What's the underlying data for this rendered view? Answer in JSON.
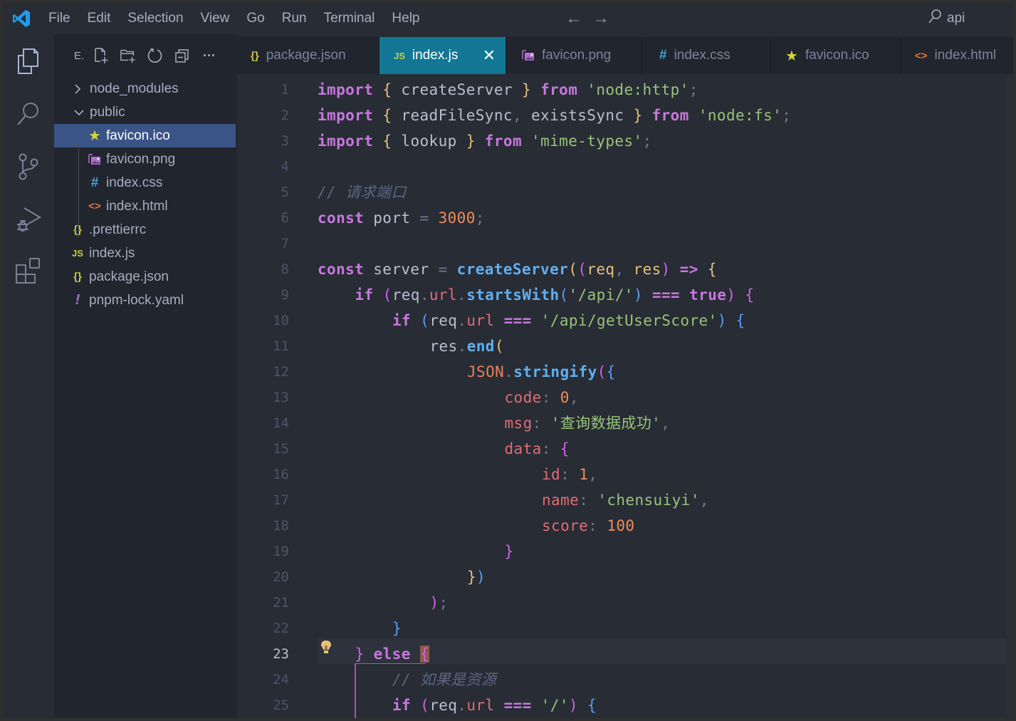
{
  "app": {
    "menu": [
      "File",
      "Edit",
      "Selection",
      "View",
      "Go",
      "Run",
      "Terminal",
      "Help"
    ],
    "nav": {
      "back": "←",
      "forward": "→"
    },
    "command_center": {
      "icon": "search-icon",
      "text": "api"
    }
  },
  "activity_bar": [
    {
      "name": "explorer",
      "icon": "files-icon",
      "active": true
    },
    {
      "name": "search",
      "icon": "search-icon"
    },
    {
      "name": "source-control",
      "icon": "source-control-icon"
    },
    {
      "name": "run-and-debug",
      "icon": "run-debug-icon"
    },
    {
      "name": "extensions",
      "icon": "extensions-icon"
    }
  ],
  "explorer": {
    "title": "E.",
    "actions": [
      "new-file",
      "new-folder",
      "refresh",
      "collapse-all",
      "more"
    ],
    "more_label": "···",
    "tree": [
      {
        "label": "node_modules",
        "type": "folder",
        "expanded": false,
        "depth": 0
      },
      {
        "label": "public",
        "type": "folder",
        "expanded": true,
        "depth": 0
      },
      {
        "label": "favicon.ico",
        "type": "file",
        "icon": "star-icon",
        "icon_glyph": "★",
        "icon_color": "#d4d43a",
        "depth": 1,
        "selected": true
      },
      {
        "label": "favicon.png",
        "type": "file",
        "icon": "image-icon",
        "icon_glyph": "🖼",
        "icon_color": "#b46fd1",
        "depth": 1
      },
      {
        "label": "index.css",
        "type": "file",
        "icon": "hash-icon",
        "icon_glyph": "#",
        "icon_color": "#42a5d5",
        "depth": 1
      },
      {
        "label": "index.html",
        "type": "file",
        "icon": "html-icon",
        "icon_glyph": "<>",
        "icon_color": "#e6773a",
        "depth": 1
      },
      {
        "label": ".prettierrc",
        "type": "file",
        "icon": "braces-icon",
        "icon_glyph": "{}",
        "icon_color": "#cbcb41",
        "depth": 0
      },
      {
        "label": "index.js",
        "type": "file",
        "icon": "js-icon",
        "icon_glyph": "JS",
        "icon_color": "#cbcb41",
        "depth": 0
      },
      {
        "label": "package.json",
        "type": "file",
        "icon": "braces-icon",
        "icon_glyph": "{}",
        "icon_color": "#cbcb41",
        "depth": 0
      },
      {
        "label": "pnpm-lock.yaml",
        "type": "file",
        "icon": "exclamation-icon",
        "icon_glyph": "!",
        "icon_color": "#a074c4",
        "depth": 0
      }
    ]
  },
  "tabs": [
    {
      "label": "package.json",
      "icon": "braces-icon",
      "icon_glyph": "{}",
      "icon_color": "#cbcb41"
    },
    {
      "label": "index.js",
      "icon": "js-icon",
      "icon_glyph": "JS",
      "icon_color": "#cbcb41",
      "active": true,
      "close": "✕"
    },
    {
      "label": "favicon.png",
      "icon": "image-icon",
      "icon_glyph": "🖼",
      "icon_color": "#b46fd1"
    },
    {
      "label": "index.css",
      "icon": "hash-icon",
      "icon_glyph": "#",
      "icon_color": "#42a5d5"
    },
    {
      "label": "favicon.ico",
      "icon": "star-icon",
      "icon_glyph": "★",
      "icon_color": "#d4d43a"
    },
    {
      "label": "index.html",
      "icon": "html-icon",
      "icon_glyph": "<>",
      "icon_color": "#e6773a"
    }
  ],
  "editor": {
    "current_line": 23,
    "lines": [
      [
        [
          "kw",
          "import"
        ],
        [
          "",
          "  "
        ],
        [
          "b1",
          "{"
        ],
        [
          "",
          " createServer "
        ],
        [
          "b1",
          "}"
        ],
        [
          "",
          " "
        ],
        [
          "kw",
          "from"
        ],
        [
          "",
          " "
        ],
        [
          "str",
          "'node:http'"
        ],
        [
          "pun",
          ";"
        ]
      ],
      [
        [
          "kw",
          "import"
        ],
        [
          "",
          " "
        ],
        [
          "b1",
          "{"
        ],
        [
          "",
          " readFileSync"
        ],
        [
          "pun",
          ","
        ],
        [
          "",
          " existsSync "
        ],
        [
          "b1",
          "}"
        ],
        [
          "",
          " "
        ],
        [
          "kw",
          "from"
        ],
        [
          "",
          " "
        ],
        [
          "str",
          "'node:fs'"
        ],
        [
          "pun",
          ";"
        ]
      ],
      [
        [
          "kw",
          "import"
        ],
        [
          "",
          " "
        ],
        [
          "b1",
          "{"
        ],
        [
          "",
          " lookup "
        ],
        [
          "b1",
          "}"
        ],
        [
          "",
          " "
        ],
        [
          "kw",
          "from"
        ],
        [
          "",
          " "
        ],
        [
          "str",
          "'mime-types'"
        ],
        [
          "pun",
          ";"
        ]
      ],
      [],
      [
        [
          "cm",
          "// 请求端口"
        ]
      ],
      [
        [
          "kw",
          "const"
        ],
        [
          "",
          " port "
        ],
        [
          "pun",
          "="
        ],
        [
          "",
          " "
        ],
        [
          "num",
          "3000"
        ],
        [
          "pun",
          ";"
        ]
      ],
      [],
      [
        [
          "kw",
          "const"
        ],
        [
          "",
          " server "
        ],
        [
          "pun",
          "="
        ],
        [
          "",
          " "
        ],
        [
          "fn",
          "createServer"
        ],
        [
          "b1",
          "("
        ],
        [
          "b2",
          "("
        ],
        [
          "par",
          "req"
        ],
        [
          "pun",
          ","
        ],
        [
          "",
          " "
        ],
        [
          "par",
          "res"
        ],
        [
          "b2",
          ")"
        ],
        [
          "",
          " "
        ],
        [
          "kw",
          "=>"
        ],
        [
          "",
          " "
        ],
        [
          "b1",
          "{"
        ]
      ],
      [
        [
          "",
          ""
        ],
        [
          "kw",
          "if"
        ],
        [
          "",
          " "
        ],
        [
          "b2",
          "("
        ],
        [
          "",
          "req"
        ],
        [
          "pun",
          "."
        ],
        [
          "prop",
          "url"
        ],
        [
          "pun",
          "."
        ],
        [
          "fn",
          "startsWith"
        ],
        [
          "b3",
          "("
        ],
        [
          "str",
          "'/api/'"
        ],
        [
          "b3",
          ")"
        ],
        [
          "",
          " "
        ],
        [
          "kw",
          "==="
        ],
        [
          "",
          " "
        ],
        [
          "kw",
          "true"
        ],
        [
          "b2",
          ")"
        ],
        [
          "",
          " "
        ],
        [
          "b2",
          "{"
        ]
      ],
      [
        [
          "",
          ""
        ],
        [
          "kw",
          "if"
        ],
        [
          "",
          " "
        ],
        [
          "b3",
          "("
        ],
        [
          "",
          "req"
        ],
        [
          "pun",
          "."
        ],
        [
          "prop",
          "url"
        ],
        [
          "",
          " "
        ],
        [
          "kw",
          "==="
        ],
        [
          "",
          " "
        ],
        [
          "str",
          "'/api/getUserScore'"
        ],
        [
          "b3",
          ")"
        ],
        [
          "",
          " "
        ],
        [
          "b3",
          "{"
        ]
      ],
      [
        [
          "",
          ""
        ],
        [
          "",
          "res"
        ],
        [
          "pun",
          "."
        ],
        [
          "fn",
          "end"
        ],
        [
          "b1",
          "("
        ]
      ],
      [
        [
          "",
          ""
        ],
        [
          "obj",
          "JSON"
        ],
        [
          "pun",
          "."
        ],
        [
          "fn",
          "stringify"
        ],
        [
          "b2",
          "("
        ],
        [
          "b3",
          "{"
        ]
      ],
      [
        [
          "",
          ""
        ],
        [
          "prop",
          "code"
        ],
        [
          "pun",
          ":"
        ],
        [
          "",
          " "
        ],
        [
          "num",
          "0"
        ],
        [
          "pun",
          ","
        ]
      ],
      [
        [
          "",
          ""
        ],
        [
          "prop",
          "msg"
        ],
        [
          "pun",
          ":"
        ],
        [
          "",
          " "
        ],
        [
          "str",
          "'查询数据成功'"
        ],
        [
          "pun",
          ","
        ]
      ],
      [
        [
          "",
          ""
        ],
        [
          "prop",
          "data"
        ],
        [
          "pun",
          ":"
        ],
        [
          "",
          " "
        ],
        [
          "b2",
          "{"
        ]
      ],
      [
        [
          "",
          ""
        ],
        [
          "prop",
          "id"
        ],
        [
          "pun",
          ":"
        ],
        [
          "",
          " "
        ],
        [
          "num",
          "1"
        ],
        [
          "pun",
          ","
        ]
      ],
      [
        [
          "",
          ""
        ],
        [
          "prop",
          "name"
        ],
        [
          "pun",
          ":"
        ],
        [
          "",
          " "
        ],
        [
          "str",
          "'chensuiyi'"
        ],
        [
          "pun",
          ","
        ]
      ],
      [
        [
          "",
          ""
        ],
        [
          "prop",
          "score"
        ],
        [
          "pun",
          ":"
        ],
        [
          "",
          " "
        ],
        [
          "num",
          "100"
        ]
      ],
      [
        [
          "",
          ""
        ],
        [
          "b2",
          "}"
        ]
      ],
      [
        [
          "",
          ""
        ],
        [
          "b1",
          "}"
        ],
        [
          "b3",
          ")"
        ]
      ],
      [
        [
          "",
          ""
        ],
        [
          "b2",
          ")"
        ],
        [
          "pun",
          ";"
        ]
      ],
      [
        [
          "",
          ""
        ],
        [
          "b3",
          "}"
        ]
      ],
      [
        [
          "",
          ""
        ],
        [
          "b2",
          "}"
        ],
        [
          "",
          " "
        ],
        [
          "kw",
          "else"
        ],
        [
          "",
          " "
        ],
        [
          "b2hl",
          "{"
        ]
      ],
      [
        [
          "",
          ""
        ],
        [
          "cm",
          "// 如果是资源"
        ]
      ],
      [
        [
          "",
          ""
        ],
        [
          "kw",
          "if"
        ],
        [
          "",
          " "
        ],
        [
          "b2",
          "("
        ],
        [
          "",
          "req"
        ],
        [
          "pun",
          "."
        ],
        [
          "prop",
          "url"
        ],
        [
          "",
          " "
        ],
        [
          "kw",
          "==="
        ],
        [
          "",
          " "
        ],
        [
          "str",
          "'/'"
        ],
        [
          "b2",
          ")"
        ],
        [
          "",
          " "
        ],
        [
          "b3",
          "{"
        ]
      ]
    ],
    "indents": [
      0,
      0,
      0,
      0,
      0,
      0,
      0,
      0,
      1,
      2,
      3,
      4,
      5,
      5,
      5,
      6,
      6,
      6,
      5,
      4,
      3,
      2,
      1,
      2,
      2
    ]
  }
}
